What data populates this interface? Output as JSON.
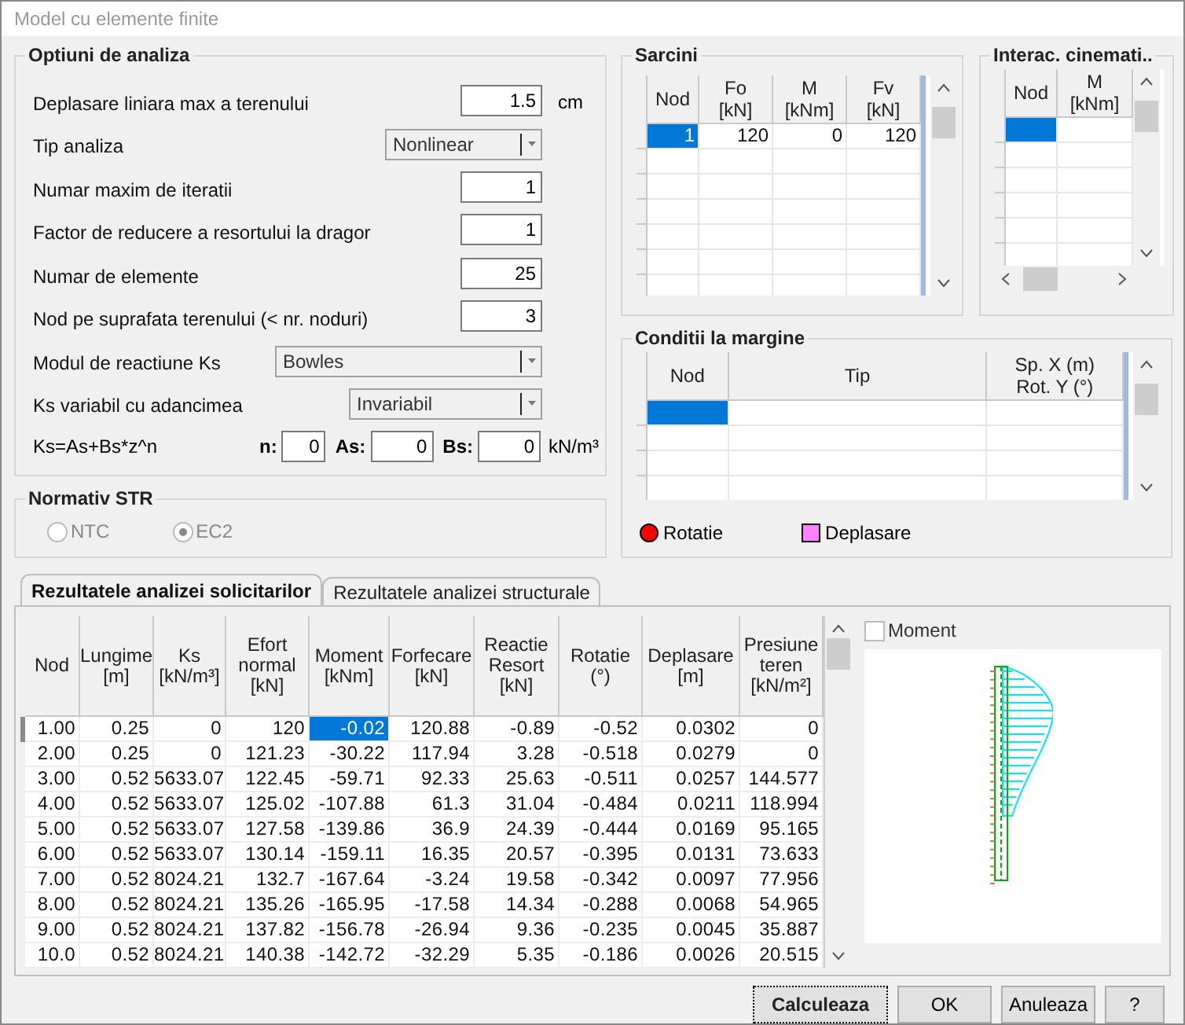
{
  "window": {
    "title": "Model cu elemente finite"
  },
  "options": {
    "title": "Optiuni de analiza",
    "fields": [
      {
        "kind": "number",
        "label": "Deplasare liniara max a terenului",
        "value": "1.5",
        "unit": "cm"
      },
      {
        "kind": "select",
        "label": "Tip analiza",
        "value": "Nonlinear"
      },
      {
        "kind": "number",
        "label": "Numar maxim de iteratii",
        "value": "1"
      },
      {
        "kind": "number",
        "label": "Factor de reducere a resortului la dragor",
        "value": "1"
      },
      {
        "kind": "number",
        "label": "Numar de elemente",
        "value": "25"
      },
      {
        "kind": "number",
        "label": "Nod pe suprafata terenului (< nr. noduri)",
        "value": "3"
      },
      {
        "kind": "select",
        "label": "Modul de reactiune Ks",
        "value": "Bowles"
      },
      {
        "kind": "select",
        "label": "Ks variabil cu adancimea",
        "value": "Invariabil"
      }
    ],
    "formula": {
      "label": "Ks=As+Bs*z^n",
      "params": [
        {
          "label": "n:",
          "value": "0"
        },
        {
          "label": "As:",
          "value": "0"
        },
        {
          "label": "Bs:",
          "value": "0"
        }
      ],
      "unit": "kN/m³"
    }
  },
  "normativ": {
    "title": "Normativ STR",
    "disabled": true,
    "options": [
      {
        "label": "NTC",
        "selected": false
      },
      {
        "label": "EC2",
        "selected": true
      }
    ]
  },
  "sarcini": {
    "title": "Sarcini",
    "columns": [
      {
        "lines": [
          "Nod"
        ]
      },
      {
        "lines": [
          "Fo",
          "[kN]"
        ]
      },
      {
        "lines": [
          "M",
          "[kNm]"
        ]
      },
      {
        "lines": [
          "Fv",
          "[kN]"
        ]
      }
    ],
    "rows": [
      {
        "cells": [
          "1",
          "120",
          "0",
          "120"
        ],
        "selected": true
      }
    ]
  },
  "interac": {
    "title": "Interac. cinemati..",
    "columns": [
      {
        "lines": [
          "Nod"
        ]
      },
      {
        "lines": [
          "M",
          "[kNm]"
        ]
      }
    ],
    "cursor": true
  },
  "conditii": {
    "title": "Conditii la margine",
    "columns": [
      {
        "lines": [
          "Nod"
        ]
      },
      {
        "lines": [
          "Tip"
        ]
      },
      {
        "lines": [
          "Sp. X (m)",
          "Rot. Y (°)"
        ]
      }
    ],
    "cursor": true,
    "legend": [
      {
        "kind": "circle",
        "label": "Rotatie",
        "color": "#ff0000"
      },
      {
        "kind": "square",
        "label": "Deplasare",
        "color": "#ff80ff"
      }
    ]
  },
  "tabs": [
    {
      "label": "Rezultatele analizei solicitarilor",
      "selected": true
    },
    {
      "label": "Rezultatele analizei structurale",
      "selected": false
    }
  ],
  "results": {
    "columns": [
      {
        "lines": [
          "Nod"
        ],
        "selected": false
      },
      {
        "lines": [
          "Lungime",
          "[m]"
        ],
        "selected": false
      },
      {
        "lines": [
          "Ks",
          "[kN/m³]"
        ],
        "selected": false
      },
      {
        "lines": [
          "Efort",
          "normal",
          "[kN]"
        ],
        "selected": false
      },
      {
        "lines": [
          "Moment",
          "[kNm]"
        ],
        "selected": true
      },
      {
        "lines": [
          "Forfecare",
          "[kN]"
        ],
        "selected": false
      },
      {
        "lines": [
          "Reactie",
          "Resort",
          "[kN]"
        ],
        "selected": false
      },
      {
        "lines": [
          "Rotatie",
          "(°)"
        ],
        "selected": false
      },
      {
        "lines": [
          "Deplasare",
          "[m]"
        ],
        "selected": false
      },
      {
        "lines": [
          "Presiune",
          "teren",
          "[kN/m²]"
        ],
        "selected": false
      }
    ],
    "rows": [
      {
        "cells": [
          "1.00",
          "0.25",
          "0",
          "120",
          "-0.02",
          "120.88",
          "-0.89",
          "-0.52",
          "0.0302",
          "0"
        ],
        "selected": true
      },
      {
        "cells": [
          "2.00",
          "0.25",
          "0",
          "121.23",
          "-30.22",
          "117.94",
          "3.28",
          "-0.518",
          "0.0279",
          "0"
        ],
        "selected": false
      },
      {
        "cells": [
          "3.00",
          "0.52",
          "5633.07",
          "122.45",
          "-59.71",
          "92.33",
          "25.63",
          "-0.511",
          "0.0257",
          "144.577"
        ],
        "selected": false
      },
      {
        "cells": [
          "4.00",
          "0.52",
          "5633.07",
          "125.02",
          "-107.88",
          "61.3",
          "31.04",
          "-0.484",
          "0.0211",
          "118.994"
        ],
        "selected": false
      },
      {
        "cells": [
          "5.00",
          "0.52",
          "5633.07",
          "127.58",
          "-139.86",
          "36.9",
          "24.39",
          "-0.444",
          "0.0169",
          "95.165"
        ],
        "selected": false
      },
      {
        "cells": [
          "6.00",
          "0.52",
          "5633.07",
          "130.14",
          "-159.11",
          "16.35",
          "20.57",
          "-0.395",
          "0.0131",
          "73.633"
        ],
        "selected": false
      },
      {
        "cells": [
          "7.00",
          "0.52",
          "8024.21",
          "132.7",
          "-167.64",
          "-3.24",
          "19.58",
          "-0.342",
          "0.0097",
          "77.956"
        ],
        "selected": false
      },
      {
        "cells": [
          "8.00",
          "0.52",
          "8024.21",
          "135.26",
          "-165.95",
          "-17.58",
          "14.34",
          "-0.288",
          "0.0068",
          "54.965"
        ],
        "selected": false
      },
      {
        "cells": [
          "9.00",
          "0.52",
          "8024.21",
          "137.82",
          "-156.78",
          "-26.94",
          "9.36",
          "-0.235",
          "0.0045",
          "35.887"
        ],
        "selected": false
      },
      {
        "cells": [
          "10.0",
          "0.52",
          "8024.21",
          "140.38",
          "-142.72",
          "-32.29",
          "5.35",
          "-0.186",
          "0.0026",
          "20.515"
        ],
        "selected": false
      }
    ]
  },
  "moment_checkbox": {
    "label": "Moment",
    "checked": false
  },
  "buttons": [
    {
      "label": "Calculeaza",
      "focused": true
    },
    {
      "label": "OK",
      "focused": false
    },
    {
      "label": "Anuleaza",
      "focused": false
    },
    {
      "label": "?",
      "focused": false
    }
  ]
}
